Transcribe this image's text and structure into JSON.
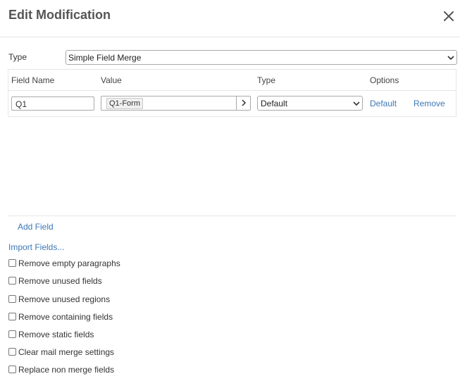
{
  "dialog": {
    "title": "Edit Modification"
  },
  "type": {
    "label": "Type",
    "selected": "Simple Field Merge"
  },
  "grid": {
    "columns": [
      "Field Name",
      "Value",
      "Type",
      "Options"
    ],
    "rows": [
      {
        "field_name": "Q1",
        "value_tag": "Q1-Form",
        "type": "Default",
        "option_default": "Default",
        "option_remove": "Remove"
      }
    ]
  },
  "actions": {
    "add_field": "Add Field",
    "import_fields": "Import Fields..."
  },
  "options": [
    {
      "label": "Remove empty paragraphs",
      "checked": false
    },
    {
      "label": "Remove unused fields",
      "checked": false
    },
    {
      "label": "Remove unused regions",
      "checked": false
    },
    {
      "label": "Remove containing fields",
      "checked": false
    },
    {
      "label": "Remove static fields",
      "checked": false
    },
    {
      "label": "Clear mail merge settings",
      "checked": false
    },
    {
      "label": "Replace non merge fields",
      "checked": false
    }
  ],
  "colors": {
    "link": "#3b78b5",
    "title": "#555555",
    "border": "#a9a9a9"
  },
  "icons": {
    "close": "close-icon",
    "dropdown": "chevron-down-icon",
    "expand": "chevron-right-icon"
  }
}
